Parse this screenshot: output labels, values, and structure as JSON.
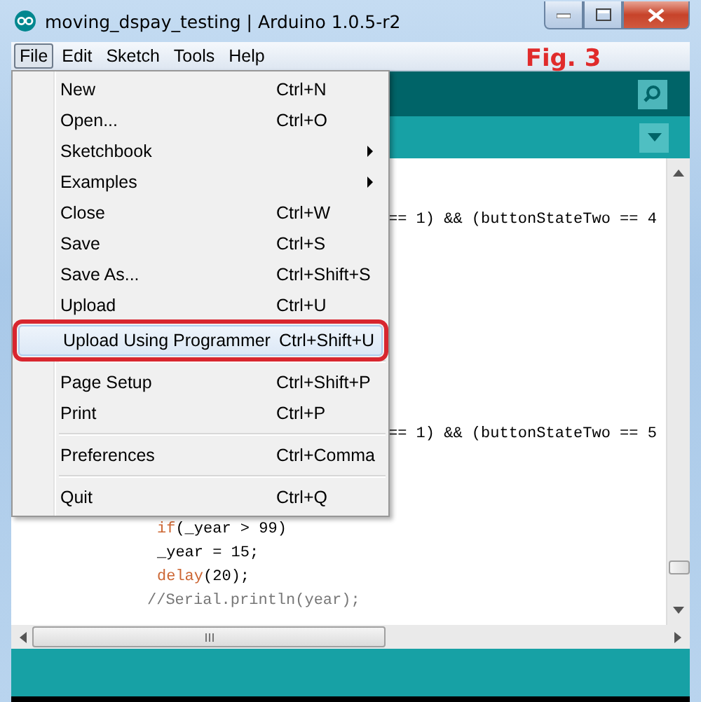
{
  "window": {
    "title": "moving_dspay_testing | Arduino 1.0.5-r2"
  },
  "menubar": [
    {
      "label": "File",
      "selected": true
    },
    {
      "label": "Edit",
      "selected": false
    },
    {
      "label": "Sketch",
      "selected": false
    },
    {
      "label": "Tools",
      "selected": false
    },
    {
      "label": "Help",
      "selected": false
    }
  ],
  "annotation": {
    "text": "Fig. 3"
  },
  "file_menu": [
    {
      "kind": "item",
      "label": "New",
      "shortcut": "Ctrl+N",
      "submenu": false,
      "selected": false
    },
    {
      "kind": "item",
      "label": "Open...",
      "shortcut": "Ctrl+O",
      "submenu": false,
      "selected": false
    },
    {
      "kind": "item",
      "label": "Sketchbook",
      "submenu": true,
      "selected": false
    },
    {
      "kind": "item",
      "label": "Examples",
      "submenu": true,
      "selected": false
    },
    {
      "kind": "item",
      "label": "Close",
      "shortcut": "Ctrl+W",
      "submenu": false,
      "selected": false
    },
    {
      "kind": "item",
      "label": "Save",
      "shortcut": "Ctrl+S",
      "submenu": false,
      "selected": false
    },
    {
      "kind": "item",
      "label": "Save As...",
      "shortcut": "Ctrl+Shift+S",
      "submenu": false,
      "selected": false
    },
    {
      "kind": "item",
      "label": "Upload",
      "shortcut": "Ctrl+U",
      "submenu": false,
      "selected": false
    },
    {
      "kind": "item",
      "label": "Upload Using Programmer",
      "shortcut": "Ctrl+Shift+U",
      "submenu": false,
      "selected": true,
      "outlined": true
    },
    {
      "kind": "separator"
    },
    {
      "kind": "item",
      "label": "Page Setup",
      "shortcut": "Ctrl+Shift+P",
      "submenu": false,
      "selected": false
    },
    {
      "kind": "item",
      "label": "Print",
      "shortcut": "Ctrl+P",
      "submenu": false,
      "selected": false
    },
    {
      "kind": "separator"
    },
    {
      "kind": "item",
      "label": "Preferences",
      "shortcut": "Ctrl+Comma",
      "submenu": false,
      "selected": false
    },
    {
      "kind": "separator"
    },
    {
      "kind": "item",
      "label": "Quit",
      "shortcut": "Ctrl+Q",
      "submenu": false,
      "selected": false
    }
  ],
  "editor": {
    "lines": [
      {
        "parts": [
          {
            "kind": "plain",
            "text": "== 1) && (buttonStateTwo == 4"
          }
        ]
      },
      {
        "parts": [
          {
            "kind": "plain",
            "text": "== 1) && (buttonStateTwo == 5"
          }
        ]
      },
      {
        "parts": [
          {
            "kind": "keyword",
            "text": "if"
          },
          {
            "kind": "plain",
            "text": "(_year > 99)"
          }
        ]
      },
      {
        "parts": [
          {
            "kind": "plain",
            "text": "_year = 15;"
          }
        ]
      },
      {
        "parts": [
          {
            "kind": "keyword",
            "text": "delay"
          },
          {
            "kind": "plain",
            "text": "(20);"
          }
        ]
      },
      {
        "parts": [
          {
            "kind": "comment",
            "text": "//Serial.println(year);"
          }
        ]
      }
    ]
  }
}
